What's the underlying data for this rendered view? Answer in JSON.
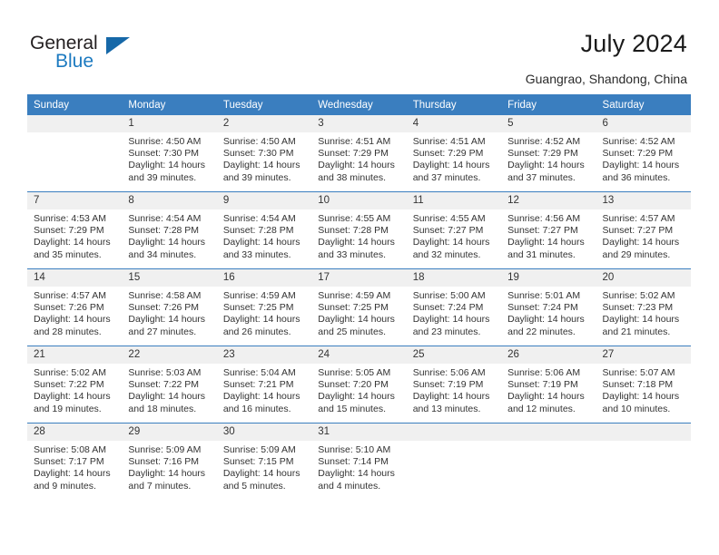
{
  "brand": {
    "name_part1": "General",
    "name_part2": "Blue",
    "triangle_icon": "triangle-icon",
    "accent_color": "#1c7ac0"
  },
  "header": {
    "title": "July 2024",
    "subtitle": "Guangrao, Shandong, China"
  },
  "calendar": {
    "header_color": "#3a7ebf",
    "daynum_band_color": "#f0f0f0",
    "weekdays": [
      "Sunday",
      "Monday",
      "Tuesday",
      "Wednesday",
      "Thursday",
      "Friday",
      "Saturday"
    ],
    "weeks": [
      [
        {
          "day": "",
          "sunrise": "",
          "sunset": "",
          "daylight_line1": "",
          "daylight_line2": ""
        },
        {
          "day": "1",
          "sunrise": "Sunrise: 4:50 AM",
          "sunset": "Sunset: 7:30 PM",
          "daylight_line1": "Daylight: 14 hours",
          "daylight_line2": "and 39 minutes."
        },
        {
          "day": "2",
          "sunrise": "Sunrise: 4:50 AM",
          "sunset": "Sunset: 7:30 PM",
          "daylight_line1": "Daylight: 14 hours",
          "daylight_line2": "and 39 minutes."
        },
        {
          "day": "3",
          "sunrise": "Sunrise: 4:51 AM",
          "sunset": "Sunset: 7:29 PM",
          "daylight_line1": "Daylight: 14 hours",
          "daylight_line2": "and 38 minutes."
        },
        {
          "day": "4",
          "sunrise": "Sunrise: 4:51 AM",
          "sunset": "Sunset: 7:29 PM",
          "daylight_line1": "Daylight: 14 hours",
          "daylight_line2": "and 37 minutes."
        },
        {
          "day": "5",
          "sunrise": "Sunrise: 4:52 AM",
          "sunset": "Sunset: 7:29 PM",
          "daylight_line1": "Daylight: 14 hours",
          "daylight_line2": "and 37 minutes."
        },
        {
          "day": "6",
          "sunrise": "Sunrise: 4:52 AM",
          "sunset": "Sunset: 7:29 PM",
          "daylight_line1": "Daylight: 14 hours",
          "daylight_line2": "and 36 minutes."
        }
      ],
      [
        {
          "day": "7",
          "sunrise": "Sunrise: 4:53 AM",
          "sunset": "Sunset: 7:29 PM",
          "daylight_line1": "Daylight: 14 hours",
          "daylight_line2": "and 35 minutes."
        },
        {
          "day": "8",
          "sunrise": "Sunrise: 4:54 AM",
          "sunset": "Sunset: 7:28 PM",
          "daylight_line1": "Daylight: 14 hours",
          "daylight_line2": "and 34 minutes."
        },
        {
          "day": "9",
          "sunrise": "Sunrise: 4:54 AM",
          "sunset": "Sunset: 7:28 PM",
          "daylight_line1": "Daylight: 14 hours",
          "daylight_line2": "and 33 minutes."
        },
        {
          "day": "10",
          "sunrise": "Sunrise: 4:55 AM",
          "sunset": "Sunset: 7:28 PM",
          "daylight_line1": "Daylight: 14 hours",
          "daylight_line2": "and 33 minutes."
        },
        {
          "day": "11",
          "sunrise": "Sunrise: 4:55 AM",
          "sunset": "Sunset: 7:27 PM",
          "daylight_line1": "Daylight: 14 hours",
          "daylight_line2": "and 32 minutes."
        },
        {
          "day": "12",
          "sunrise": "Sunrise: 4:56 AM",
          "sunset": "Sunset: 7:27 PM",
          "daylight_line1": "Daylight: 14 hours",
          "daylight_line2": "and 31 minutes."
        },
        {
          "day": "13",
          "sunrise": "Sunrise: 4:57 AM",
          "sunset": "Sunset: 7:27 PM",
          "daylight_line1": "Daylight: 14 hours",
          "daylight_line2": "and 29 minutes."
        }
      ],
      [
        {
          "day": "14",
          "sunrise": "Sunrise: 4:57 AM",
          "sunset": "Sunset: 7:26 PM",
          "daylight_line1": "Daylight: 14 hours",
          "daylight_line2": "and 28 minutes."
        },
        {
          "day": "15",
          "sunrise": "Sunrise: 4:58 AM",
          "sunset": "Sunset: 7:26 PM",
          "daylight_line1": "Daylight: 14 hours",
          "daylight_line2": "and 27 minutes."
        },
        {
          "day": "16",
          "sunrise": "Sunrise: 4:59 AM",
          "sunset": "Sunset: 7:25 PM",
          "daylight_line1": "Daylight: 14 hours",
          "daylight_line2": "and 26 minutes."
        },
        {
          "day": "17",
          "sunrise": "Sunrise: 4:59 AM",
          "sunset": "Sunset: 7:25 PM",
          "daylight_line1": "Daylight: 14 hours",
          "daylight_line2": "and 25 minutes."
        },
        {
          "day": "18",
          "sunrise": "Sunrise: 5:00 AM",
          "sunset": "Sunset: 7:24 PM",
          "daylight_line1": "Daylight: 14 hours",
          "daylight_line2": "and 23 minutes."
        },
        {
          "day": "19",
          "sunrise": "Sunrise: 5:01 AM",
          "sunset": "Sunset: 7:24 PM",
          "daylight_line1": "Daylight: 14 hours",
          "daylight_line2": "and 22 minutes."
        },
        {
          "day": "20",
          "sunrise": "Sunrise: 5:02 AM",
          "sunset": "Sunset: 7:23 PM",
          "daylight_line1": "Daylight: 14 hours",
          "daylight_line2": "and 21 minutes."
        }
      ],
      [
        {
          "day": "21",
          "sunrise": "Sunrise: 5:02 AM",
          "sunset": "Sunset: 7:22 PM",
          "daylight_line1": "Daylight: 14 hours",
          "daylight_line2": "and 19 minutes."
        },
        {
          "day": "22",
          "sunrise": "Sunrise: 5:03 AM",
          "sunset": "Sunset: 7:22 PM",
          "daylight_line1": "Daylight: 14 hours",
          "daylight_line2": "and 18 minutes."
        },
        {
          "day": "23",
          "sunrise": "Sunrise: 5:04 AM",
          "sunset": "Sunset: 7:21 PM",
          "daylight_line1": "Daylight: 14 hours",
          "daylight_line2": "and 16 minutes."
        },
        {
          "day": "24",
          "sunrise": "Sunrise: 5:05 AM",
          "sunset": "Sunset: 7:20 PM",
          "daylight_line1": "Daylight: 14 hours",
          "daylight_line2": "and 15 minutes."
        },
        {
          "day": "25",
          "sunrise": "Sunrise: 5:06 AM",
          "sunset": "Sunset: 7:19 PM",
          "daylight_line1": "Daylight: 14 hours",
          "daylight_line2": "and 13 minutes."
        },
        {
          "day": "26",
          "sunrise": "Sunrise: 5:06 AM",
          "sunset": "Sunset: 7:19 PM",
          "daylight_line1": "Daylight: 14 hours",
          "daylight_line2": "and 12 minutes."
        },
        {
          "day": "27",
          "sunrise": "Sunrise: 5:07 AM",
          "sunset": "Sunset: 7:18 PM",
          "daylight_line1": "Daylight: 14 hours",
          "daylight_line2": "and 10 minutes."
        }
      ],
      [
        {
          "day": "28",
          "sunrise": "Sunrise: 5:08 AM",
          "sunset": "Sunset: 7:17 PM",
          "daylight_line1": "Daylight: 14 hours",
          "daylight_line2": "and 9 minutes."
        },
        {
          "day": "29",
          "sunrise": "Sunrise: 5:09 AM",
          "sunset": "Sunset: 7:16 PM",
          "daylight_line1": "Daylight: 14 hours",
          "daylight_line2": "and 7 minutes."
        },
        {
          "day": "30",
          "sunrise": "Sunrise: 5:09 AM",
          "sunset": "Sunset: 7:15 PM",
          "daylight_line1": "Daylight: 14 hours",
          "daylight_line2": "and 5 minutes."
        },
        {
          "day": "31",
          "sunrise": "Sunrise: 5:10 AM",
          "sunset": "Sunset: 7:14 PM",
          "daylight_line1": "Daylight: 14 hours",
          "daylight_line2": "and 4 minutes."
        },
        {
          "day": "",
          "sunrise": "",
          "sunset": "",
          "daylight_line1": "",
          "daylight_line2": ""
        },
        {
          "day": "",
          "sunrise": "",
          "sunset": "",
          "daylight_line1": "",
          "daylight_line2": ""
        },
        {
          "day": "",
          "sunrise": "",
          "sunset": "",
          "daylight_line1": "",
          "daylight_line2": ""
        }
      ]
    ]
  }
}
